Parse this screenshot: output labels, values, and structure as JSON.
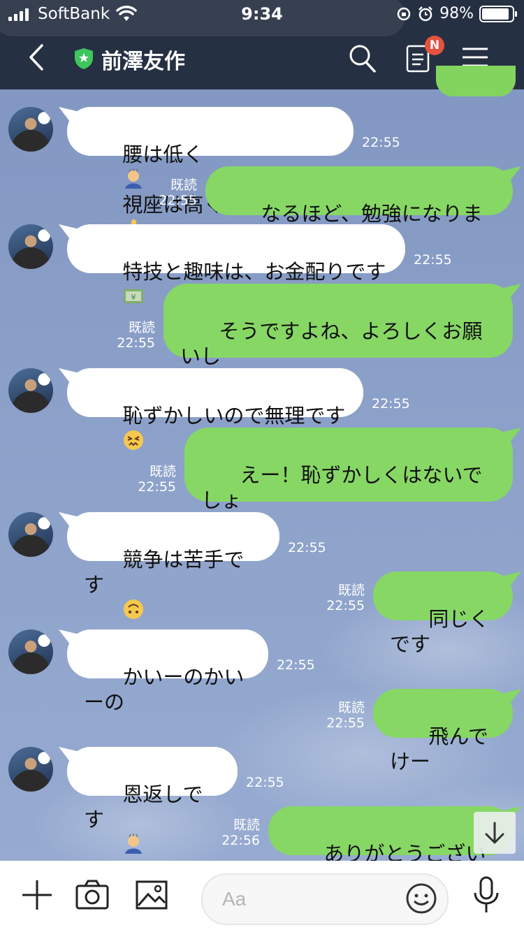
{
  "status_bar": {
    "carrier": "SoftBank",
    "time": "9:34",
    "battery": "98%"
  },
  "header": {
    "title": "前澤友作",
    "notes_badge": "N"
  },
  "messages": [
    {
      "side": "in",
      "text": "腰は低く",
      "emoji1": "bowing-person",
      "text2": "視座は高く",
      "emoji2": "pointing-up",
      "time": "22:55"
    },
    {
      "side": "out",
      "text": "なるほど、勉強になります。",
      "read": "既読",
      "time": "22:55"
    },
    {
      "side": "in",
      "text": "特技と趣味は、お金配りです",
      "emoji1": "money-bill",
      "time": "22:55"
    },
    {
      "side": "out",
      "text": "そうですよね、よろしくお願いし\nます。",
      "read": "既読",
      "time": "22:55"
    },
    {
      "side": "in",
      "text": "恥ずかしいので無理です",
      "emoji1": "confounded-face",
      "time": "22:55"
    },
    {
      "side": "out",
      "text": "えー！恥ずかしくはないでしょ\nう…",
      "read": "既読",
      "time": "22:55"
    },
    {
      "side": "in",
      "text": "競争は苦手です",
      "emoji1": "upside-down-face",
      "time": "22:55"
    },
    {
      "side": "out",
      "text": "同じくです",
      "read": "既読",
      "time": "22:55"
    },
    {
      "side": "in",
      "text": "かいーのかいーの",
      "time": "22:55"
    },
    {
      "side": "out",
      "text": "飛んでけー",
      "read": "既読",
      "time": "22:55"
    },
    {
      "side": "in",
      "text": "恩返しです",
      "emoji1": "bowing-person",
      "time": "22:55"
    },
    {
      "side": "out",
      "text": "ありがとうございます",
      "read": "既読",
      "time": "22:56"
    }
  ],
  "composer": {
    "placeholder": "Aa"
  },
  "colors": {
    "header_bg": "#263043",
    "bubble_out": "#87d765",
    "bubble_in": "#ffffff",
    "badge": "#e4533d"
  }
}
